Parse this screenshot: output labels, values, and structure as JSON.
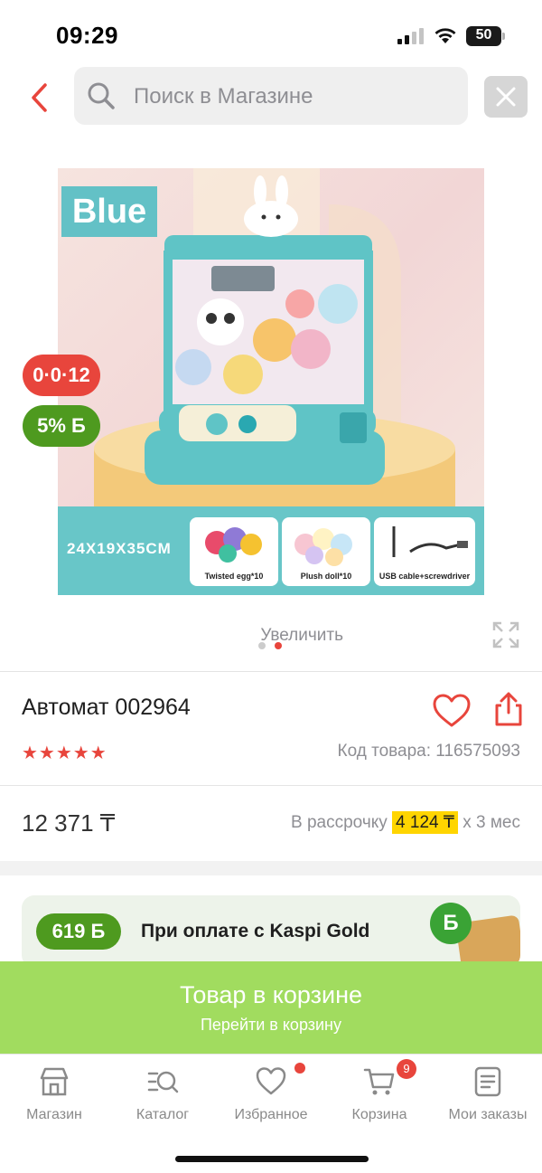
{
  "status_bar": {
    "time": "09:29",
    "battery": "50"
  },
  "search": {
    "placeholder": "Поиск в Магазине"
  },
  "product_image": {
    "label": "Blue",
    "size_text": "24X19X35CM",
    "cards": [
      "Twisted egg*10",
      "Plush doll*10",
      "USB cable+screwdriver"
    ],
    "pages_total": 2,
    "page_active": 2
  },
  "badges": {
    "installment": "0·0·12",
    "bonus": "5% Б"
  },
  "zoom": {
    "label": "Увеличить"
  },
  "product": {
    "title": "Автомат 002964",
    "rating": 5,
    "stars": "★★★★★",
    "sku": "Код товара: 116575093"
  },
  "price": {
    "value": "12 371 ₸",
    "installment_prefix": "В рассрочку",
    "installment_amount": "4 124 ₸",
    "installment_suffix": "х 3 мес"
  },
  "kaspi": {
    "bonus": "619 Б",
    "text": "При оплате с Kaspi Gold",
    "coin": "Б"
  },
  "cart_banner": {
    "title": "Товар в корзине",
    "subtitle": "Перейти в корзину"
  },
  "tabbar": {
    "items": [
      {
        "label": "Магазин",
        "icon": "store-icon"
      },
      {
        "label": "Каталог",
        "icon": "catalog-search-icon"
      },
      {
        "label": "Избранное",
        "icon": "heart-icon"
      },
      {
        "label": "Корзина",
        "icon": "cart-icon"
      },
      {
        "label": "Мои заказы",
        "icon": "orders-icon"
      }
    ],
    "cart_count": "9"
  },
  "colors": {
    "accent_red": "#e8453c",
    "kaspi_green": "#4e9a1f",
    "cart_banner": "#a1dc5f",
    "installment_highlight": "#ffd500"
  }
}
